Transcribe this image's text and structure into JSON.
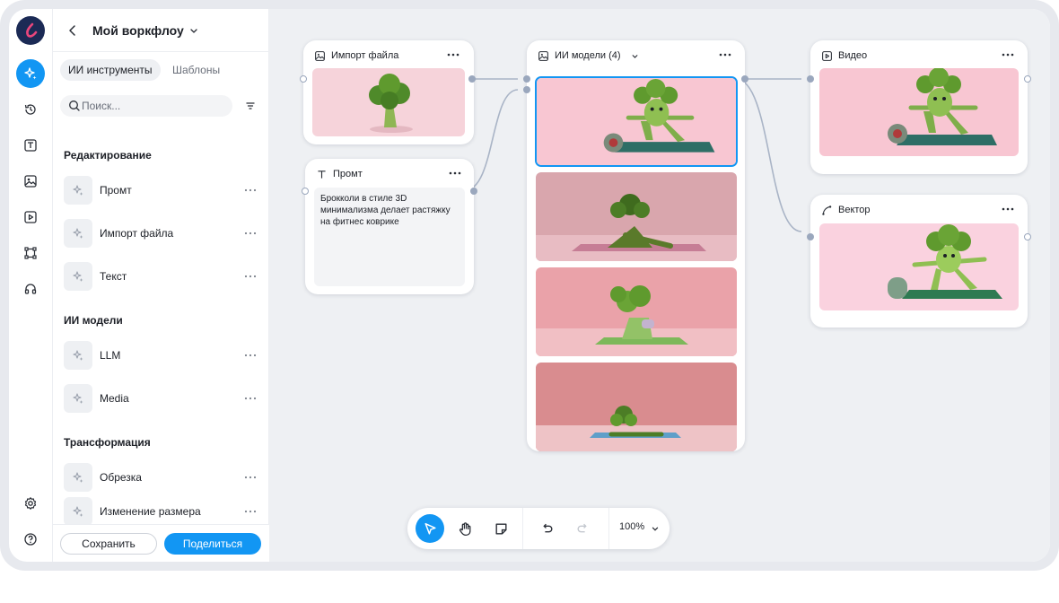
{
  "workflow": {
    "title": "Мой воркфлоу"
  },
  "tabs": [
    {
      "label": "ИИ инструменты",
      "active": true
    },
    {
      "label": "Шаблоны",
      "active": false
    }
  ],
  "search": {
    "placeholder": "Поиск..."
  },
  "sections": [
    {
      "title": "Редактирование",
      "items": [
        "Промт",
        "Импорт файла",
        "Текст"
      ]
    },
    {
      "title": "ИИ модели",
      "items": [
        "LLM",
        "Media"
      ]
    },
    {
      "title": "Трансформация",
      "items": [
        "Обрезка",
        "Изменение размера"
      ]
    }
  ],
  "footer": {
    "save_label": "Сохранить",
    "share_label": "Поделиться"
  },
  "rail": {
    "icons": [
      "magic-tools-icon",
      "history-icon",
      "text-icon",
      "image-icon",
      "video-icon",
      "vector-icon",
      "headset-icon",
      "settings-icon",
      "help-icon"
    ]
  },
  "nodes": {
    "import": {
      "title": "Импорт файла"
    },
    "prompt": {
      "title": "Промт",
      "text": "Брокколи в стиле 3D минимализма делает растяжку на фитнес коврике"
    },
    "models": {
      "title": "ИИ модели (4)"
    },
    "video": {
      "title": "Видео"
    },
    "vector": {
      "title": "Вектор"
    }
  },
  "toolbar": {
    "zoom": "100%"
  },
  "colors": {
    "accent": "#1296f3",
    "canvas": "#eef0f3",
    "broccoli": "#5f9a2e",
    "pink": "#f6c9d3"
  }
}
